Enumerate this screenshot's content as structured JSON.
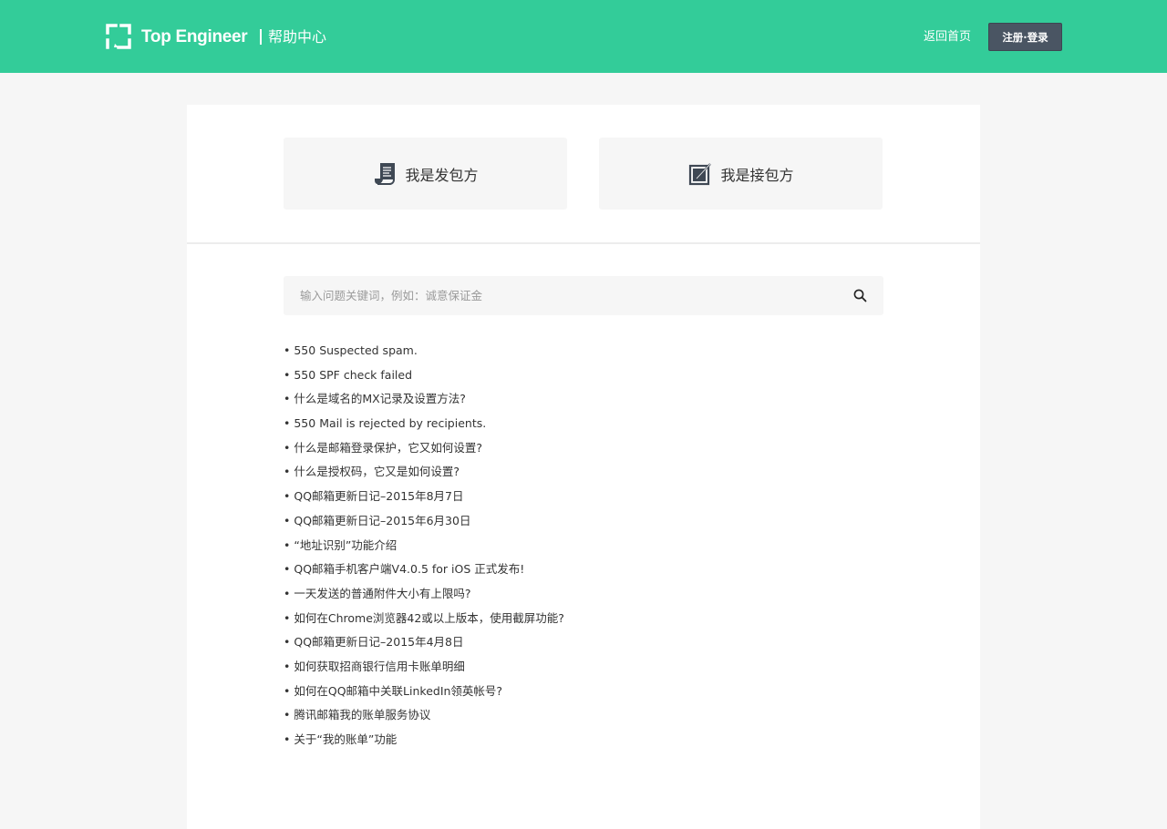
{
  "header": {
    "brand": "Top Engineer",
    "section": "帮助中心",
    "back_link": "返回首页",
    "auth_button": "注册·登录",
    "bg_color": "#33cc99"
  },
  "roles": [
    {
      "label": "我是发包方",
      "icon": "scroll-document-icon"
    },
    {
      "label": "我是接包方",
      "icon": "edit-document-icon"
    }
  ],
  "search": {
    "placeholder": "输入问题关键词，例如：诚意保证金",
    "value": "",
    "icon": "search-icon"
  },
  "faq": [
    "550 Suspected spam.",
    "550 SPF check failed",
    "什么是域名的MX记录及设置方法?",
    "550 Mail is rejected by recipients.",
    "什么是邮箱登录保护，它又如何设置?",
    "什么是授权码，它又是如何设置?",
    "QQ邮箱更新日记–2015年8月7日",
    "QQ邮箱更新日记–2015年6月30日",
    "“地址识别”功能介绍",
    "QQ邮箱手机客户端V4.0.5 for iOS 正式发布!",
    "一天发送的普通附件大小有上限吗?",
    "如何在Chrome浏览器42或以上版本，使用截屏功能?",
    "QQ邮箱更新日记–2015年4月8日",
    "如何获取招商银行信用卡账单明细",
    "如何在QQ邮箱中关联LinkedIn领英帐号?",
    "腾讯邮箱我的账单服务协议",
    "关于“我的账单”功能"
  ]
}
